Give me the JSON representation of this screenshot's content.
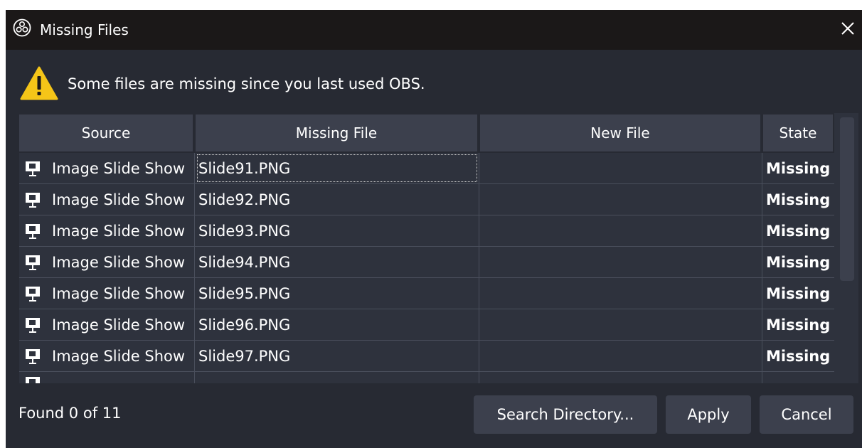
{
  "window": {
    "title": "Missing Files",
    "title_icon": "obs-logo-icon",
    "close_icon": "close-icon"
  },
  "message": {
    "text": "Some files are missing since you last used OBS.",
    "icon": "warning-icon",
    "icon_color": "#f5c518"
  },
  "table": {
    "columns": [
      "Source",
      "Missing File",
      "New File",
      "State"
    ],
    "rows": [
      {
        "source": "Image Slide Show",
        "missing_file": "Slide91.PNG",
        "new_file": "",
        "state": "Missing"
      },
      {
        "source": "Image Slide Show",
        "missing_file": "Slide92.PNG",
        "new_file": "",
        "state": "Missing"
      },
      {
        "source": "Image Slide Show",
        "missing_file": "Slide93.PNG",
        "new_file": "",
        "state": "Missing"
      },
      {
        "source": "Image Slide Show",
        "missing_file": "Slide94.PNG",
        "new_file": "",
        "state": "Missing"
      },
      {
        "source": "Image Slide Show",
        "missing_file": "Slide95.PNG",
        "new_file": "",
        "state": "Missing"
      },
      {
        "source": "Image Slide Show",
        "missing_file": "Slide96.PNG",
        "new_file": "",
        "state": "Missing"
      },
      {
        "source": "Image Slide Show",
        "missing_file": "Slide97.PNG",
        "new_file": "",
        "state": "Missing"
      },
      {
        "source": "",
        "missing_file": "",
        "new_file": "",
        "state": ""
      }
    ]
  },
  "status": {
    "text": "Found 0 of 11"
  },
  "buttons": {
    "search": "Search Directory...",
    "apply": "Apply",
    "cancel": "Cancel"
  },
  "colors": {
    "background": "#272a33",
    "titlebar": "#1b1818",
    "header": "#3c404d",
    "table_bg": "#2e323d"
  }
}
